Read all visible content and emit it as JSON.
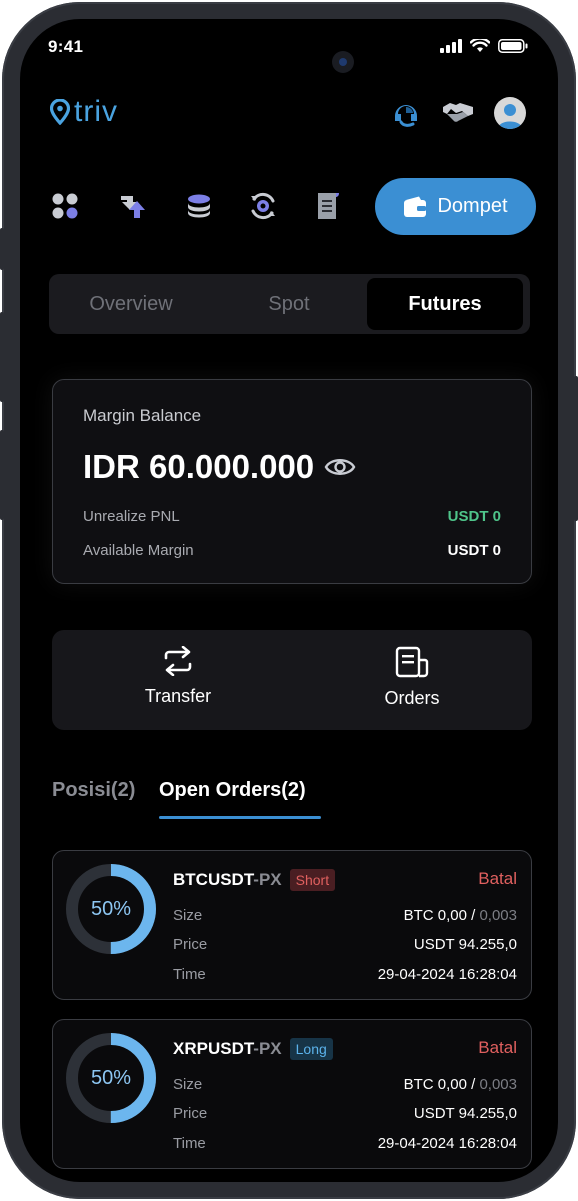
{
  "status_bar": {
    "time": "9:41"
  },
  "header": {
    "brand": "triv"
  },
  "wallet_button": {
    "label": "Dompet"
  },
  "segments": [
    {
      "label": "Overview",
      "active": false
    },
    {
      "label": "Spot",
      "active": false
    },
    {
      "label": "Futures",
      "active": true
    }
  ],
  "balance": {
    "title": "Margin Balance",
    "amount": "IDR 60.000.000",
    "rows": [
      {
        "label": "Unrealize PNL",
        "value": "USDT 0",
        "color": "#4fc48a"
      },
      {
        "label": "Available Margin",
        "value": "USDT 0",
        "color": "#ffffff"
      }
    ]
  },
  "actions": {
    "transfer": "Transfer",
    "orders": "Orders"
  },
  "tabs": {
    "positions": "Posisi(2)",
    "open_orders": "Open Orders(2)",
    "active": "open_orders"
  },
  "orders": [
    {
      "percent": "50%",
      "fill_fraction": 0.5,
      "symbol": "BTCUSDT",
      "suffix": "-PX",
      "side": "Short",
      "cancel": "Batal",
      "size_label": "Size",
      "size_value": "BTC 0,00 /",
      "size_total": "0,003",
      "price_label": "Price",
      "price_value": "USDT 94.255,0",
      "time_label": "Time",
      "time_value": "29-04-2024 16:28:04"
    },
    {
      "percent": "50%",
      "fill_fraction": 0.5,
      "symbol": "XRPUSDT",
      "suffix": "-PX",
      "side": "Long",
      "cancel": "Batal",
      "size_label": "Size",
      "size_value": "BTC 0,00 /",
      "size_total": "0,003",
      "price_label": "Price",
      "price_value": "USDT 94.255,0",
      "time_label": "Time",
      "time_value": "29-04-2024 16:28:04"
    }
  ],
  "colors": {
    "accent": "#3b8fd3",
    "negative": "#e0605f",
    "positive": "#4fc48a",
    "donut_fill": "#6cb6ee",
    "donut_track": "#2d3138"
  }
}
